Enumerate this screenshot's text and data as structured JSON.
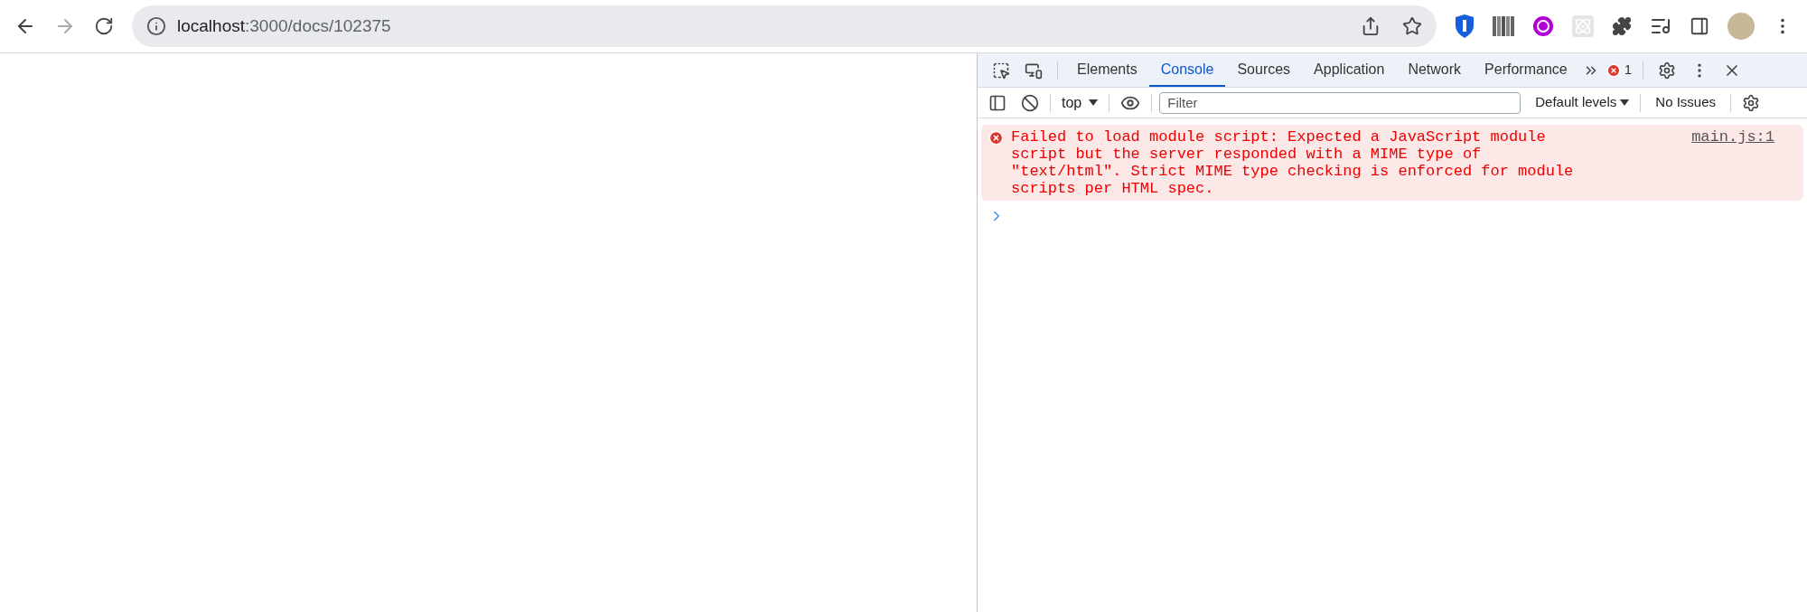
{
  "browser": {
    "url_host": "localhost",
    "url_path": ":3000/docs/102375"
  },
  "devtools": {
    "tabs": [
      {
        "label": "Elements",
        "selected": false
      },
      {
        "label": "Console",
        "selected": true
      },
      {
        "label": "Sources",
        "selected": false
      },
      {
        "label": "Application",
        "selected": false
      },
      {
        "label": "Network",
        "selected": false
      },
      {
        "label": "Performance",
        "selected": false
      }
    ],
    "error_count": "1",
    "toolbar": {
      "context": "top",
      "filter_placeholder": "Filter",
      "levels": "Default levels",
      "issues": "No Issues"
    },
    "messages": [
      {
        "kind": "error",
        "text": "Failed to load module script: Expected a JavaScript module script but the server responded with a MIME type of \"text/html\". Strict MIME type checking is enforced for module scripts per HTML spec.",
        "source": "main.js:1"
      }
    ]
  }
}
